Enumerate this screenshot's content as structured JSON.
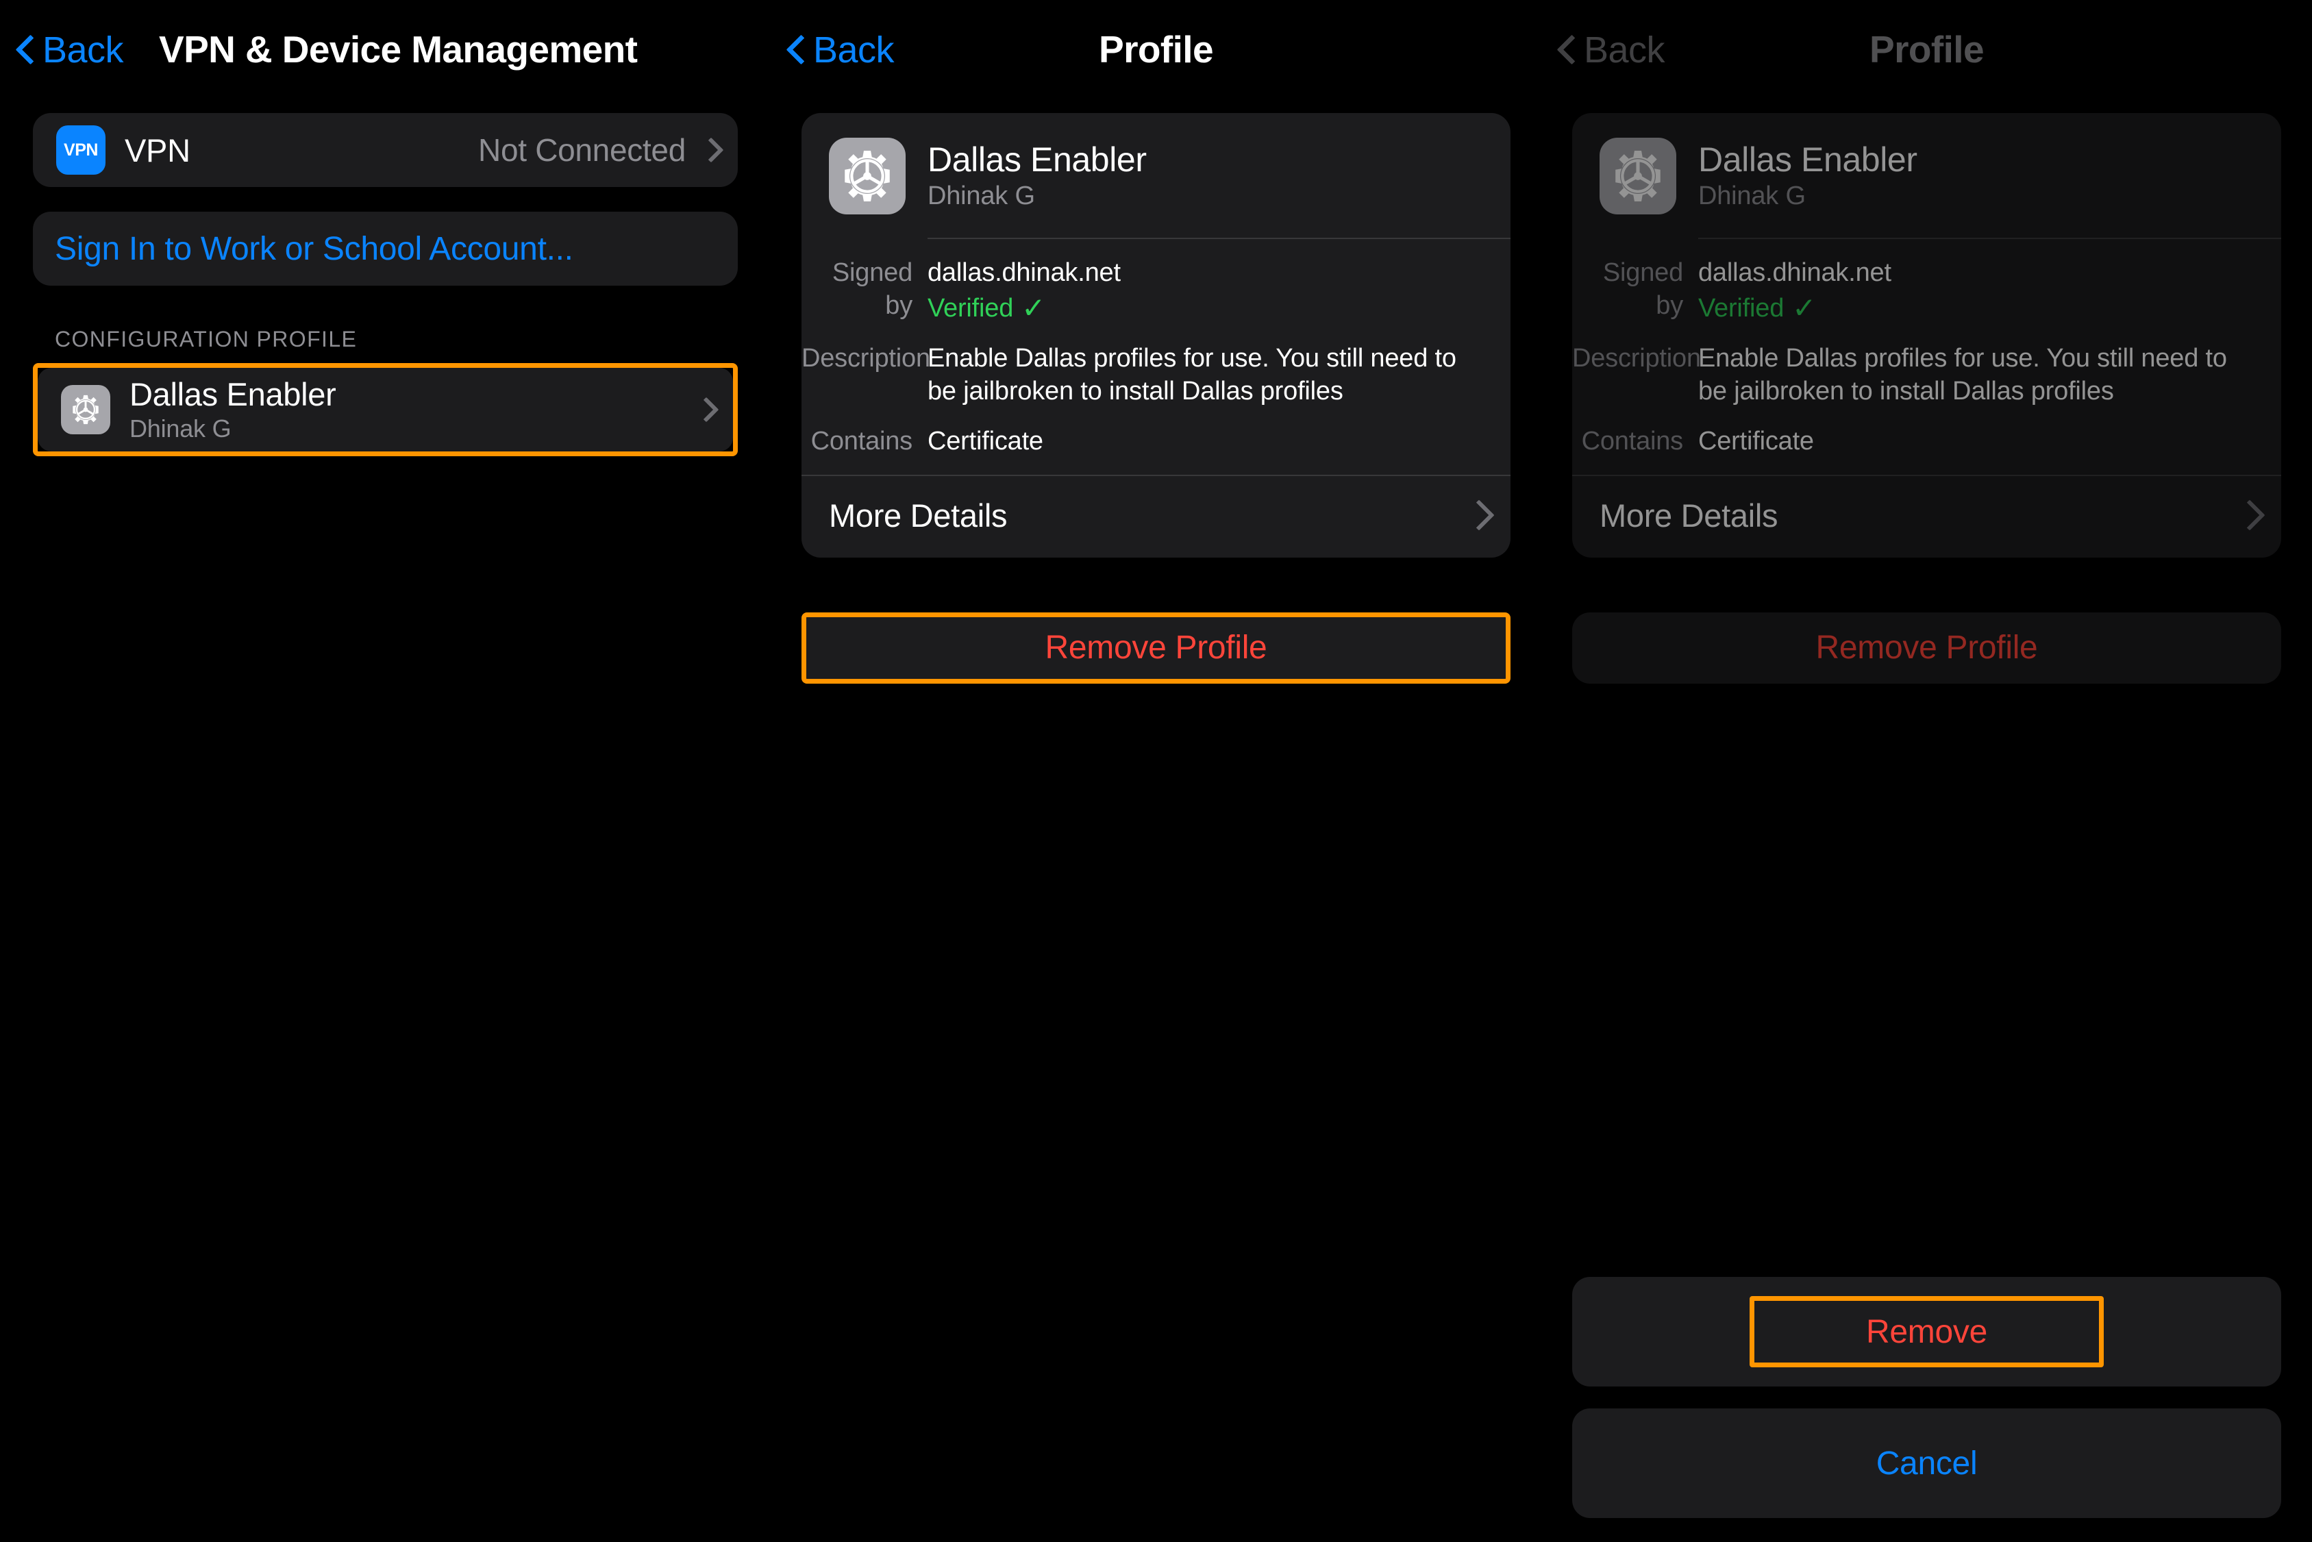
{
  "meta": {
    "accent_orange": "#ff9500",
    "accent_blue": "#0a84ff",
    "destructive_red": "#ff453a",
    "verified_green": "#30d158",
    "card_bg": "#1c1c1e",
    "page_bg": "#000000"
  },
  "panels": {
    "left": {
      "nav": {
        "back_label": "Back",
        "title": "VPN & Device Management"
      },
      "vpn_row": {
        "icon_label": "VPN",
        "label": "VPN",
        "value": "Not Connected"
      },
      "signin": {
        "label": "Sign In to Work or School Account..."
      },
      "section_header": "CONFIGURATION PROFILE",
      "profile_row": {
        "title": "Dallas Enabler",
        "subtitle": "Dhinak G",
        "highlighted": true
      }
    },
    "middle": {
      "nav": {
        "back_label": "Back",
        "title": "Profile"
      },
      "profile": {
        "name": "Dallas Enabler",
        "author": "Dhinak G",
        "fields": [
          {
            "key": "Signed by",
            "value": "dallas.dhinak.net",
            "status": "Verified"
          },
          {
            "key": "Description",
            "value": "Enable Dallas profiles for use. You still need to be jailbroken to install Dallas profiles"
          },
          {
            "key": "Contains",
            "value": "Certificate"
          }
        ],
        "more_details_label": "More Details"
      },
      "remove_profile_button": {
        "label": "Remove Profile",
        "highlighted": true
      }
    },
    "right": {
      "nav": {
        "back_label": "Back",
        "title": "Profile"
      },
      "profile": {
        "name": "Dallas Enabler",
        "author": "Dhinak G",
        "fields": [
          {
            "key": "Signed by",
            "value": "dallas.dhinak.net",
            "status": "Verified"
          },
          {
            "key": "Description",
            "value": "Enable Dallas profiles for use. You still need to be jailbroken to install Dallas profiles"
          },
          {
            "key": "Contains",
            "value": "Certificate"
          }
        ],
        "more_details_label": "More Details"
      },
      "remove_profile_button": {
        "label": "Remove Profile",
        "highlighted": false
      },
      "action_sheet": {
        "remove_label": "Remove",
        "remove_highlighted": true,
        "cancel_label": "Cancel"
      }
    }
  }
}
